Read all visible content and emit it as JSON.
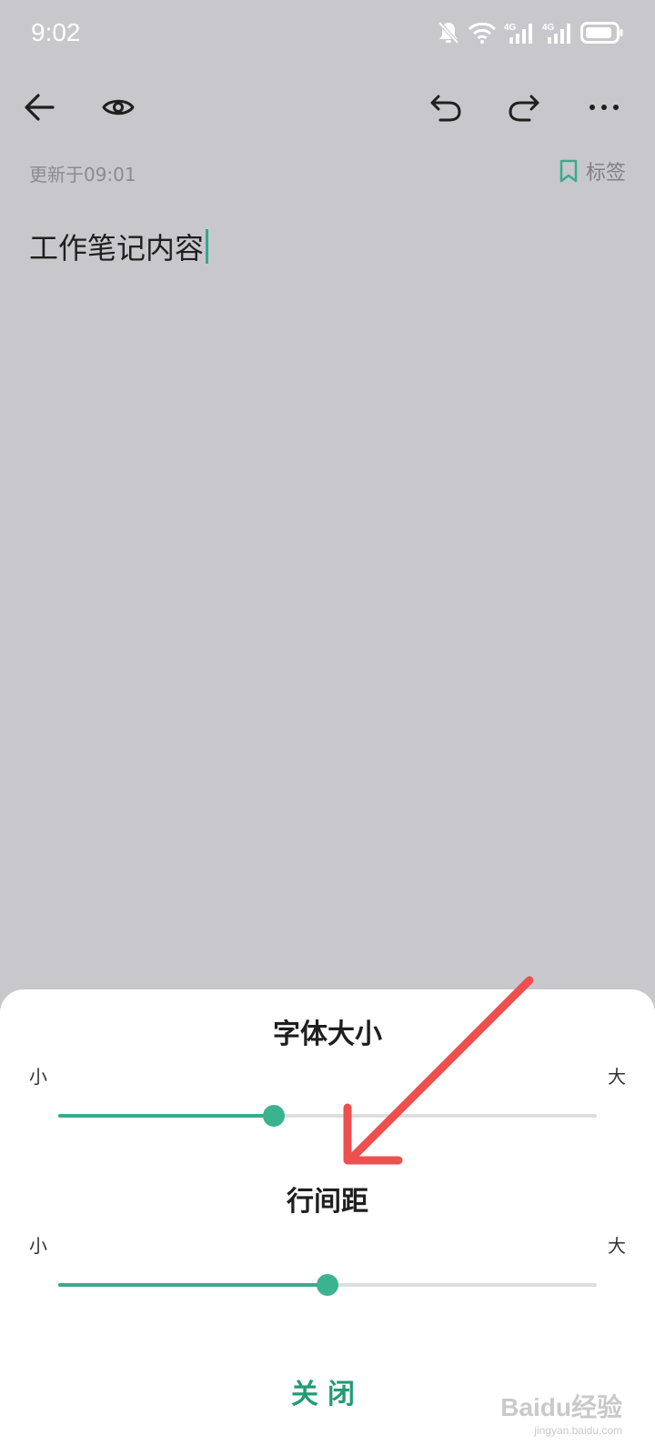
{
  "status_bar": {
    "time": "9:02",
    "icons": [
      "bell-off-icon",
      "wifi-icon",
      "4g-signal-icon",
      "4g-signal-icon",
      "battery-icon"
    ],
    "network_label": "4G"
  },
  "toolbar": {
    "icons": [
      "back-arrow-icon",
      "eye-icon",
      "undo-icon",
      "redo-icon",
      "more-icon"
    ]
  },
  "note": {
    "updated": "更新于09:01",
    "tag_label": "标签",
    "content": "工作笔记内容"
  },
  "sheet": {
    "font_size_title": "字体大小",
    "line_spacing_title": "行间距",
    "small_label": "小",
    "large_label": "大",
    "font_size_value": 0.4,
    "line_spacing_value": 0.5,
    "close_label": "关闭"
  },
  "watermark": {
    "main": "Baidu经验",
    "sub": "jingyan.baidu.com"
  },
  "colors": {
    "accent": "#3aaa8d",
    "close_text": "#239a77",
    "annotation_arrow": "#ee4f4f"
  }
}
